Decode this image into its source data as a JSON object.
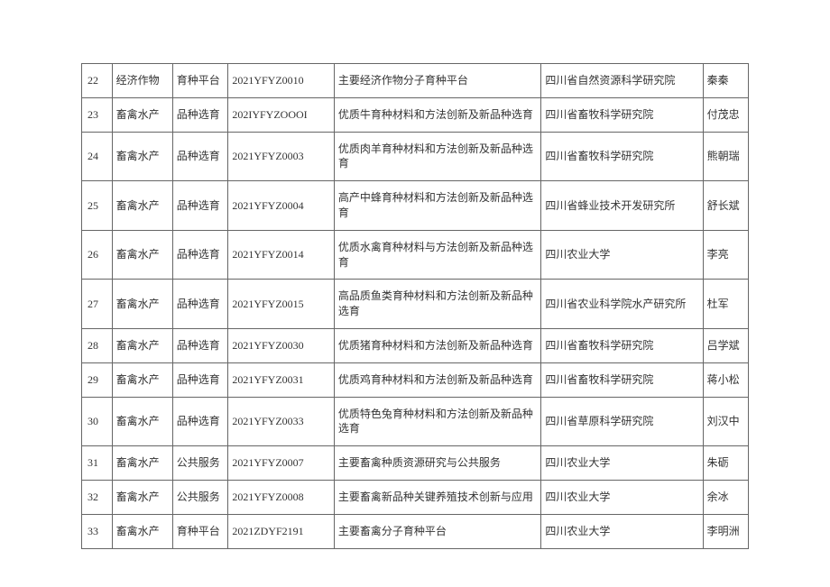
{
  "chart_data": {
    "type": "table",
    "rows": [
      {
        "idx": "22",
        "cat": "经济作物",
        "type": "育种平台",
        "code": "2021YFYZ0010",
        "name": "主要经济作物分子育种平台",
        "org": "四川省自然资源科学研究院",
        "person": "秦秦"
      },
      {
        "idx": "23",
        "cat": "畜禽水产",
        "type": "品种选育",
        "code": "202IYFYZOOOI",
        "name": "优质牛育种材料和方法创新及新品种选育",
        "org": "四川省畜牧科学研究院",
        "person": "付茂忠"
      },
      {
        "idx": "24",
        "cat": "畜禽水产",
        "type": "品种选育",
        "code": "2021YFYZ0003",
        "name": "优质肉羊育种材料和方法创新及新品种选育",
        "org": "四川省畜牧科学研究院",
        "person": "熊朝瑞"
      },
      {
        "idx": "25",
        "cat": "畜禽水产",
        "type": "品种选育",
        "code": "2021YFYZ0004",
        "name": "高产中蜂育种材料和方法创新及新品种选育",
        "org": "四川省蜂业技术开发研究所",
        "person": "舒长斌"
      },
      {
        "idx": "26",
        "cat": "畜禽水产",
        "type": "品种选育",
        "code": "2021YFYZ0014",
        "name": "优质水禽育种材料与方法创新及新品种选育",
        "org": "四川农业大学",
        "person": "李亮"
      },
      {
        "idx": "27",
        "cat": "畜禽水产",
        "type": "品种选育",
        "code": "2021YFYZ0015",
        "name": "高品质鱼类育种材料和方法创新及新品种选育",
        "org": "四川省农业科学院水产研究所",
        "person": "杜军"
      },
      {
        "idx": "28",
        "cat": "畜禽水产",
        "type": "品种选育",
        "code": "2021YFYZ0030",
        "name": "优质猪育种材料和方法创新及新品种选育",
        "org": "四川省畜牧科学研究院",
        "person": "吕学斌"
      },
      {
        "idx": "29",
        "cat": "畜禽水产",
        "type": "品种选育",
        "code": "2021YFYZ0031",
        "name": "优质鸡育种材料和方法创新及新品种选育",
        "org": "四川省畜牧科学研究院",
        "person": "蒋小松"
      },
      {
        "idx": "30",
        "cat": "畜禽水产",
        "type": "品种选育",
        "code": "2021YFYZ0033",
        "name": "优质特色兔育种材料和方法创新及新品种选育",
        "org": "四川省草原科学研究院",
        "person": "刘汉中"
      },
      {
        "idx": "31",
        "cat": "畜禽水产",
        "type": "公共服务",
        "code": "2021YFYZ0007",
        "name": "主要畜禽种质资源研究与公共服务",
        "org": "四川农业大学",
        "person": "朱砺"
      },
      {
        "idx": "32",
        "cat": "畜禽水产",
        "type": "公共服务",
        "code": "2021YFYZ0008",
        "name": "主要畜禽新品种关键养殖技术创新与应用",
        "org": "四川农业大学",
        "person": "余冰"
      },
      {
        "idx": "33",
        "cat": "畜禽水产",
        "type": "育种平台",
        "code": "2021ZDYF2191",
        "name": "主要畜禽分子育种平台",
        "org": "四川农业大学",
        "person": "李明洲"
      }
    ]
  }
}
